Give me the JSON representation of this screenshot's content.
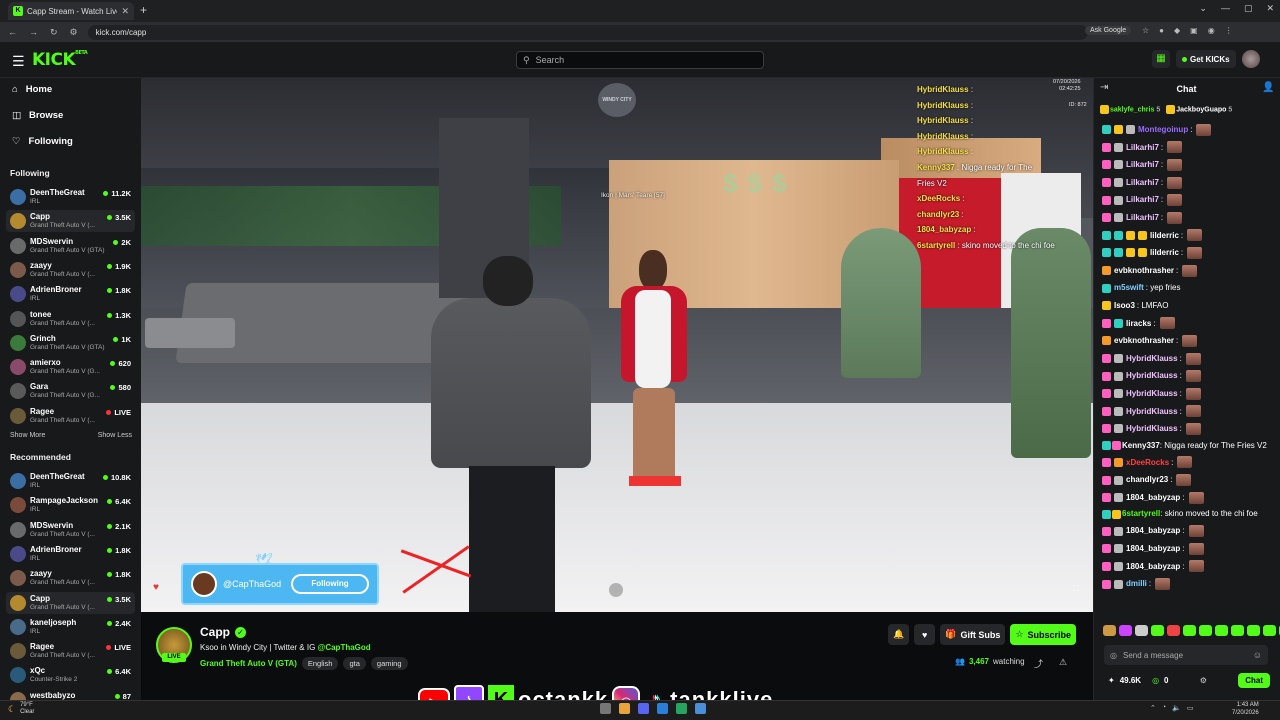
{
  "browser": {
    "tab_title": "Capp Stream - Watch Live",
    "url": "kick.com/capp",
    "ask_google": "Ask Google",
    "new_tab_glyph": "+"
  },
  "header": {
    "logo": "KICK",
    "logo_tag": "BETA",
    "search_placeholder": "Search",
    "get_kicks": "Get KICKs"
  },
  "sidebar": {
    "nav": [
      {
        "label": "Home",
        "icon": "home-icon"
      },
      {
        "label": "Browse",
        "icon": "compass-icon"
      },
      {
        "label": "Following",
        "icon": "heart-icon"
      }
    ],
    "following_header": "Following",
    "following": [
      {
        "name": "DeenTheGreat",
        "game": "IRL",
        "viewers": "11.2K",
        "color": "#3a6ea5"
      },
      {
        "name": "Capp",
        "game": "Grand Theft Auto V (...",
        "viewers": "3.5K",
        "color": "#b38a2e",
        "selected": true
      },
      {
        "name": "MDSwervin",
        "game": "Grand Theft Auto V (GTA)",
        "viewers": "2K",
        "color": "#6a6a6a"
      },
      {
        "name": "zaayy",
        "game": "Grand Theft Auto V (...",
        "viewers": "1.9K",
        "color": "#7a5a4a"
      },
      {
        "name": "AdrienBroner",
        "game": "IRL",
        "viewers": "1.8K",
        "color": "#4a4a8a"
      },
      {
        "name": "tonee",
        "game": "Grand Theft Auto V (...",
        "viewers": "1.3K",
        "color": "#555"
      },
      {
        "name": "Grinch",
        "game": "Grand Theft Auto V (GTA)",
        "viewers": "1K",
        "color": "#3a7a3a"
      },
      {
        "name": "amierxo",
        "game": "Grand Theft Auto V (G...",
        "viewers": "620",
        "color": "#8a4a6a"
      },
      {
        "name": "Gara",
        "game": "Grand Theft Auto V (G...",
        "viewers": "580",
        "color": "#5a5a5a"
      },
      {
        "name": "Ragee",
        "game": "Grand Theft Auto V (...",
        "viewers": "LIVE",
        "color": "#6a5a3a",
        "rerun": true
      }
    ],
    "show_more": "Show More",
    "show_less": "Show Less",
    "recommended_header": "Recommended",
    "recommended": [
      {
        "name": "DeenTheGreat",
        "game": "IRL",
        "viewers": "10.8K",
        "color": "#3a6ea5"
      },
      {
        "name": "RampageJackson",
        "game": "IRL",
        "viewers": "6.4K",
        "color": "#7a4a3a"
      },
      {
        "name": "MDSwervin",
        "game": "Grand Theft Auto V (...",
        "viewers": "2.1K",
        "color": "#6a6a6a"
      },
      {
        "name": "AdrienBroner",
        "game": "IRL",
        "viewers": "1.8K",
        "color": "#4a4a8a"
      },
      {
        "name": "zaayy",
        "game": "Grand Theft Auto V (...",
        "viewers": "1.8K",
        "color": "#7a5a4a"
      },
      {
        "name": "Capp",
        "game": "Grand Theft Auto V (...",
        "viewers": "3.5K",
        "color": "#b38a2e",
        "selected": true
      },
      {
        "name": "kaneljoseph",
        "game": "IRL",
        "viewers": "2.4K",
        "color": "#4a6a8a"
      },
      {
        "name": "Ragee",
        "game": "Grand Theft Auto V (...",
        "viewers": "LIVE",
        "color": "#6a5a3a",
        "rerun": true
      },
      {
        "name": "xQc",
        "game": "Counter-Strike 2",
        "viewers": "6.4K",
        "color": "#2a5a7a"
      },
      {
        "name": "westbabyzo",
        "game": "",
        "viewers": "87",
        "color": "#8a6a4a"
      }
    ]
  },
  "video": {
    "emblem": "WINDY CITY",
    "date": "07/20/2026",
    "time": "02:42:25",
    "server_id": "ID: 872",
    "player_tag": "Ikon | Mars' Teare [57]",
    "feed": [
      {
        "user": "HybridKlauss",
        "msg": ":"
      },
      {
        "user": "HybridKlauss",
        "msg": ":"
      },
      {
        "user": "HybridKlauss",
        "msg": ":"
      },
      {
        "user": "HybridKlauss",
        "msg": ":"
      },
      {
        "user": "HybridKlauss",
        "msg": ":"
      },
      {
        "user": "Kenny337",
        "msg": ": Nigga ready for The"
      },
      {
        "user": "",
        "msg": "Fries V2"
      },
      {
        "user": "xDeeRocks",
        "msg": ":"
      },
      {
        "user": "chandlyr23",
        "msg": ":"
      },
      {
        "user": "1804_babyzap",
        "msg": ":"
      },
      {
        "user": "6startyrell",
        "msg": ": skino moved to the chi foe"
      }
    ],
    "overlay_handle": "@CapThaGod",
    "overlay_button": "Following"
  },
  "stream": {
    "channel": "Capp",
    "live": "LIVE",
    "title_prefix": "Ksoo in Windy City | Twitter & IG ",
    "title_handle": "@CapThaGod",
    "category": "Grand Theft Auto V (GTA)",
    "tags": [
      "English",
      "gta",
      "gaming"
    ],
    "watching_count": "3,467",
    "watching_label": "watching",
    "gift_subs": "Gift Subs",
    "subscribe": "Subscribe"
  },
  "chat": {
    "title": "Chat",
    "pinned": [
      {
        "user": "saklyfe_chris",
        "count": "5",
        "color": "#53fc18"
      },
      {
        "user": "JackboyGuapo",
        "count": "5",
        "color": "#ffffff"
      }
    ],
    "messages": [
      {
        "badges": [
          "c",
          "y",
          "w"
        ],
        "user": "Montegoinup",
        "color": "#9a6bff",
        "text": ":",
        "emote": true
      },
      {
        "badges": [
          "p",
          "w"
        ],
        "user": "Lilkarhi7",
        "color": "#f0c0ff",
        "text": ":",
        "emote": true
      },
      {
        "badges": [
          "p",
          "w"
        ],
        "user": "Lilkarhi7",
        "color": "#f0c0ff",
        "text": ":",
        "emote": true
      },
      {
        "badges": [
          "p",
          "w"
        ],
        "user": "Lilkarhi7",
        "color": "#f0c0ff",
        "text": ":",
        "emote": true
      },
      {
        "badges": [
          "p",
          "w"
        ],
        "user": "Lilkarhi7",
        "color": "#f0c0ff",
        "text": ":",
        "emote": true
      },
      {
        "badges": [
          "p",
          "w"
        ],
        "user": "Lilkarhi7",
        "color": "#f0c0ff",
        "text": ":",
        "emote": true
      },
      {
        "badges": [
          "c",
          "c",
          "y",
          "y"
        ],
        "user": "lilderric",
        "color": "#ffffff",
        "text": ":",
        "emote": true
      },
      {
        "badges": [
          "c",
          "c",
          "y",
          "y"
        ],
        "user": "lilderric",
        "color": "#ffffff",
        "text": ":",
        "emote": true
      },
      {
        "badges": [
          "o"
        ],
        "user": "evbknothrasher",
        "color": "#ffffff",
        "text": ":",
        "emote": true
      },
      {
        "badges": [
          "c"
        ],
        "user": "m5swift",
        "color": "#7fd0ff",
        "text": ": yep fries",
        "emote": false
      },
      {
        "badges": [
          "y"
        ],
        "user": "Isoo3",
        "color": "#ffffff",
        "text": ": LMFAO",
        "emote": false
      },
      {
        "badges": [
          "p",
          "c"
        ],
        "user": "liracks",
        "color": "#ffffff",
        "text": ":",
        "emote": true
      },
      {
        "badges": [
          "o"
        ],
        "user": "evbknothrasher",
        "color": "#ffffff",
        "text": ":",
        "emote": true
      },
      {
        "badges": [
          "p",
          "w"
        ],
        "user": "HybridKlauss",
        "color": "#f0c0ff",
        "text": ":",
        "emote": true
      },
      {
        "badges": [
          "p",
          "w"
        ],
        "user": "HybridKlauss",
        "color": "#f0c0ff",
        "text": ":",
        "emote": true
      },
      {
        "badges": [
          "p",
          "w"
        ],
        "user": "HybridKlauss",
        "color": "#f0c0ff",
        "text": ":",
        "emote": true
      },
      {
        "badges": [
          "p",
          "w"
        ],
        "user": "HybridKlauss",
        "color": "#f0c0ff",
        "text": ":",
        "emote": true
      },
      {
        "badges": [
          "p",
          "w"
        ],
        "user": "HybridKlauss",
        "color": "#f0c0ff",
        "text": ":",
        "emote": true
      },
      {
        "badges": [
          "c",
          "p"
        ],
        "user": "Kenny337",
        "color": "#ffffff",
        "text": ": Nigga ready for The Fries V2",
        "emote": false,
        "wrap": true
      },
      {
        "badges": [
          "p",
          "o"
        ],
        "user": "xDeeRocks",
        "color": "#ff4040",
        "text": ":",
        "emote": true
      },
      {
        "badges": [
          "p",
          "w"
        ],
        "user": "chandlyr23",
        "color": "#ffffff",
        "text": ":",
        "emote": true
      },
      {
        "badges": [
          "p",
          "w"
        ],
        "user": "1804_babyzap",
        "color": "#ffffff",
        "text": ":",
        "emote": true
      },
      {
        "badges": [
          "c",
          "y"
        ],
        "user": "6startyrell",
        "color": "#53fc18",
        "text": ": skino moved to the chi foe",
        "emote": false,
        "wrap": true
      },
      {
        "badges": [
          "p",
          "w"
        ],
        "user": "1804_babyzap",
        "color": "#ffffff",
        "text": ":",
        "emote": true
      },
      {
        "badges": [
          "p",
          "w"
        ],
        "user": "1804_babyzap",
        "color": "#ffffff",
        "text": ":",
        "emote": true
      },
      {
        "badges": [
          "p",
          "w"
        ],
        "user": "1804_babyzap",
        "color": "#ffffff",
        "text": ":",
        "emote": true
      },
      {
        "badges": [
          "p",
          "w"
        ],
        "user": "dmilli",
        "color": "#7fd0ff",
        "text": ":",
        "emote": true
      }
    ],
    "input_placeholder": "Send a message",
    "kicks_balance": "49.6K",
    "points": "0",
    "chat_button": "Chat"
  },
  "promo": {
    "handle1": "octankk",
    "handle2": "tankklive"
  },
  "taskbar": {
    "temp": "79°F",
    "condition": "Clear",
    "time": "1:43 AM",
    "date": "7/20/2026"
  },
  "colors": {
    "accent": "#53fc18",
    "bg": "#0b0c0d",
    "panel": "#18191b"
  }
}
